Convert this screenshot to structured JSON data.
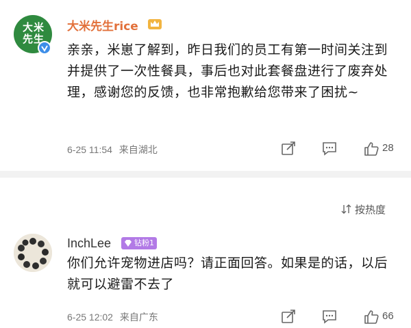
{
  "comments": [
    {
      "username": "大米先生rice",
      "avatar_text": "大米先生",
      "content": "亲亲，米崽了解到，昨日我们的员工有第一时间关注到并提供了一次性餐具，事后也对此套餐盘进行了废弃处理，感谢您的反馈，也非常抱歉给您带来了困扰~",
      "date": "6-25 11:54",
      "location": "来自湖北",
      "likes": "28",
      "brand_color": "#2f8a3f",
      "name_color": "#e2703a"
    },
    {
      "username": "InchLee",
      "fan_badge": "钻粉1",
      "content": "你们允许宠物进店吗？请正面回答。如果是的话，以后就可以避雷不去了",
      "date": "6-25 12:02",
      "location": "来自广东",
      "likes": "66"
    }
  ],
  "sort": {
    "label": "按热度"
  },
  "icons": [
    "verified-icon",
    "crown-badge-icon",
    "forward-icon",
    "comment-icon",
    "like-icon",
    "sort-icon",
    "diamond-icon"
  ]
}
